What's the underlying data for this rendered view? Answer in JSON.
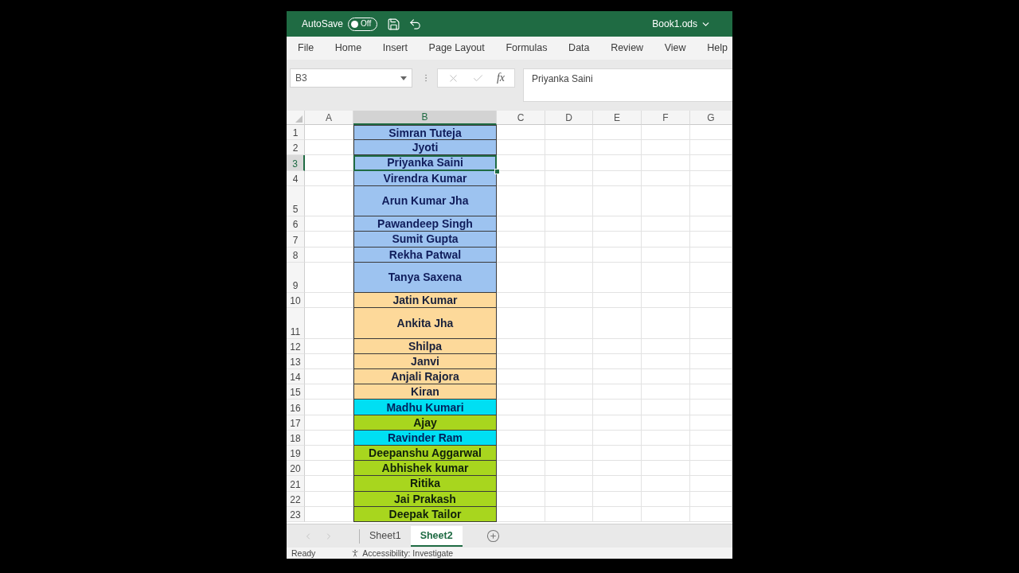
{
  "title_bar": {
    "autosave": {
      "label": "AutoSave",
      "on": false,
      "state_label": "Off"
    },
    "file_name": "Book1.ods"
  },
  "ribbon_tabs": [
    {
      "label": "File",
      "selected": false
    },
    {
      "label": "Home",
      "selected": false
    },
    {
      "label": "Insert",
      "selected": false
    },
    {
      "label": "Page Layout",
      "selected": false
    },
    {
      "label": "Formulas",
      "selected": false
    },
    {
      "label": "Data",
      "selected": false
    },
    {
      "label": "Review",
      "selected": false
    },
    {
      "label": "View",
      "selected": false
    },
    {
      "label": "Help",
      "selected": false
    }
  ],
  "formula_bar": {
    "name_box": "B3",
    "buttons": [
      {
        "kind": "cancel",
        "disabled": true
      },
      {
        "kind": "enter",
        "disabled": true
      },
      {
        "kind": "function",
        "label": "fx",
        "disabled": false
      }
    ],
    "value": "Priyanka Saini"
  },
  "columns": [
    {
      "label": "A",
      "selected": false
    },
    {
      "label": "B",
      "selected": true
    },
    {
      "label": "C",
      "selected": false
    },
    {
      "label": "D",
      "selected": false
    },
    {
      "label": "E",
      "selected": false
    },
    {
      "label": "F",
      "selected": false
    },
    {
      "label": "G",
      "selected": false
    }
  ],
  "rows": [
    {
      "number": "1",
      "name": "Simran Tuteja",
      "color": "#9dc3f0",
      "tall": false,
      "selected": false
    },
    {
      "number": "2",
      "name": "Jyoti",
      "color": "#9dc3f0",
      "tall": false,
      "selected": false
    },
    {
      "number": "3",
      "name": "Priyanka Saini",
      "color": "#9dc3f0",
      "tall": false,
      "selected": true
    },
    {
      "number": "4",
      "name": "Virendra Kumar",
      "color": "#9dc3f0",
      "tall": false,
      "selected": false
    },
    {
      "number": "5",
      "name": "Arun Kumar Jha",
      "color": "#9dc3f0",
      "tall": true,
      "selected": false
    },
    {
      "number": "6",
      "name": "Pawandeep Singh",
      "color": "#9dc3f0",
      "tall": false,
      "selected": false
    },
    {
      "number": "7",
      "name": "Sumit Gupta",
      "color": "#9dc3f0",
      "tall": false,
      "selected": false
    },
    {
      "number": "8",
      "name": "Rekha Patwal",
      "color": "#9dc3f0",
      "tall": false,
      "selected": false
    },
    {
      "number": "9",
      "name": "Tanya Saxena",
      "color": "#9dc3f0",
      "tall": true,
      "selected": false
    },
    {
      "number": "10",
      "name": "Jatin Kumar",
      "color": "#fdd99a",
      "tall": false,
      "selected": false
    },
    {
      "number": "11",
      "name": "Ankita Jha",
      "color": "#fdd99a",
      "tall": true,
      "selected": false
    },
    {
      "number": "12",
      "name": "Shilpa",
      "color": "#fdd99a",
      "tall": false,
      "selected": false
    },
    {
      "number": "13",
      "name": "Janvi",
      "color": "#fdd99a",
      "tall": false,
      "selected": false
    },
    {
      "number": "14",
      "name": "Anjali Rajora",
      "color": "#fdd99a",
      "tall": false,
      "selected": false
    },
    {
      "number": "15",
      "name": "Kiran",
      "color": "#fdd99a",
      "tall": false,
      "selected": false
    },
    {
      "number": "16",
      "name": "Madhu Kumari",
      "color": "#00dff3",
      "tall": false,
      "selected": false
    },
    {
      "number": "17",
      "name": "Ajay",
      "color": "#a8d61e",
      "tall": false,
      "selected": false
    },
    {
      "number": "18",
      "name": "Ravinder Ram",
      "color": "#00dff3",
      "tall": false,
      "selected": false
    },
    {
      "number": "19",
      "name": "Deepanshu Aggarwal",
      "color": "#a8d61e",
      "tall": false,
      "selected": false
    },
    {
      "number": "20",
      "name": "Abhishek kumar",
      "color": "#a8d61e",
      "tall": false,
      "selected": false
    },
    {
      "number": "21",
      "name": "Ritika",
      "color": "#a8d61e",
      "tall": false,
      "selected": false
    },
    {
      "number": "22",
      "name": "Jai Prakash",
      "color": "#a8d61e",
      "tall": false,
      "selected": false
    },
    {
      "number": "23",
      "name": "Deepak Tailor",
      "color": "#a8d61e",
      "tall": false,
      "selected": false
    }
  ],
  "sheet_nav": [
    {
      "kind": "previous",
      "disabled": true
    },
    {
      "kind": "next",
      "disabled": true
    }
  ],
  "sheet_tabs": [
    {
      "label": "Sheet1",
      "selected": false
    },
    {
      "label": "Sheet2",
      "selected": true
    }
  ],
  "status_bar": {
    "mode": "Ready",
    "accessibility": "Accessibility: Investigate"
  }
}
